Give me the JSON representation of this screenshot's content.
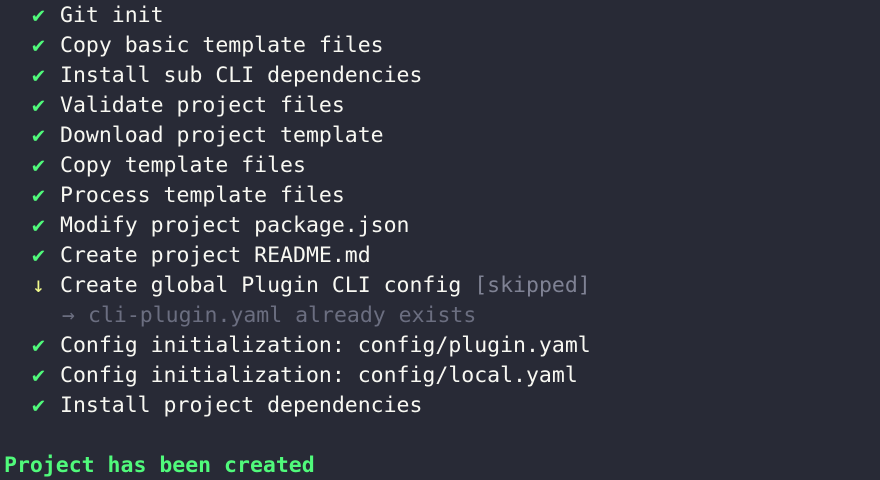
{
  "glyphs": {
    "success": "✔",
    "skipped": "↓",
    "arrow": "→"
  },
  "tasks_before": [
    {
      "label": "Git init"
    },
    {
      "label": "Copy basic template files"
    },
    {
      "label": "Install sub CLI dependencies"
    },
    {
      "label": "Validate project files"
    },
    {
      "label": "Download project template"
    },
    {
      "label": "Copy template files"
    },
    {
      "label": "Process template files"
    },
    {
      "label": "Modify project package.json"
    },
    {
      "label": "Create project README.md"
    }
  ],
  "skipped_task": {
    "label": "Create global Plugin CLI config ",
    "tag": "[skipped]",
    "note": "cli-plugin.yaml already exists"
  },
  "tasks_after": [
    {
      "label": "Config initialization: config/plugin.yaml"
    },
    {
      "label": "Config initialization: config/local.yaml"
    },
    {
      "label": "Install project dependencies"
    }
  ],
  "final_message": "Project has been created",
  "colors": {
    "background": "#282a36",
    "success": "#50fa7b",
    "warning": "#f1fa8c",
    "muted": "#6b6e80"
  }
}
